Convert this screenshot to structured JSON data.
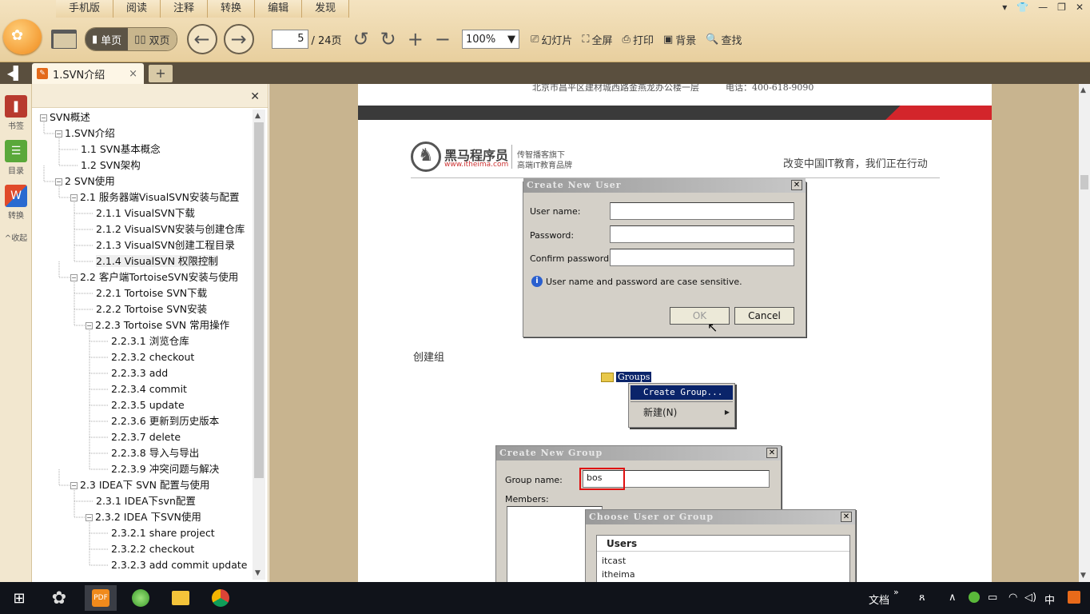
{
  "menu": [
    "手机版",
    "阅读",
    "注释",
    "转换",
    "编辑",
    "发现"
  ],
  "toolbar": {
    "single": "单页",
    "double": "双页",
    "page_current": "5",
    "page_total": "/ 24页",
    "zoom": "100%",
    "slideshow": "幻灯片",
    "fullscreen": "全屏",
    "print": "打印",
    "background": "背景",
    "find": "查找"
  },
  "tab": {
    "title": "1.SVN介绍"
  },
  "leftstrip": {
    "bookmark": "书签",
    "outline": "目录",
    "convert": "转换",
    "collapse": "收起"
  },
  "outline": [
    {
      "label": "SVN概述",
      "lv": 0,
      "tog": "−"
    },
    {
      "label": "1.SVN介绍",
      "lv": 1,
      "tog": "−"
    },
    {
      "label": "1.1 SVN基本概念",
      "lv": 2,
      "tog": ""
    },
    {
      "label": "1.2 SVN架构",
      "lv": 2,
      "tog": ""
    },
    {
      "label": "2 SVN使用",
      "lv": 1,
      "tog": "−"
    },
    {
      "label": "2.1 服务器端VisualSVN安装与配置",
      "lv": 2,
      "tog": "−"
    },
    {
      "label": "2.1.1 VisualSVN下载",
      "lv": 3,
      "tog": ""
    },
    {
      "label": "2.1.2 VisualSVN安装与创建仓库",
      "lv": 3,
      "tog": ""
    },
    {
      "label": "2.1.3 VisualSVN创建工程目录",
      "lv": 3,
      "tog": ""
    },
    {
      "label": "2.1.4 VisualSVN 权限控制",
      "lv": 3,
      "tog": "",
      "selected": true
    },
    {
      "label": "2.2 客户端TortoiseSVN安装与使用",
      "lv": 2,
      "tog": "−"
    },
    {
      "label": "2.2.1 Tortoise SVN下载",
      "lv": 3,
      "tog": ""
    },
    {
      "label": "2.2.2 Tortoise SVN安装",
      "lv": 3,
      "tog": ""
    },
    {
      "label": "2.2.3 Tortoise SVN 常用操作",
      "lv": 3,
      "tog": "−"
    },
    {
      "label": "2.2.3.1 浏览仓库",
      "lv": 4,
      "tog": ""
    },
    {
      "label": "2.2.3.2 checkout",
      "lv": 4,
      "tog": ""
    },
    {
      "label": "2.2.3.3 add",
      "lv": 4,
      "tog": ""
    },
    {
      "label": "2.2.3.4 commit",
      "lv": 4,
      "tog": ""
    },
    {
      "label": "2.2.3.5 update",
      "lv": 4,
      "tog": ""
    },
    {
      "label": "2.2.3.6 更新到历史版本",
      "lv": 4,
      "tog": ""
    },
    {
      "label": "2.2.3.7 delete",
      "lv": 4,
      "tog": ""
    },
    {
      "label": "2.2.3.8 导入与导出",
      "lv": 4,
      "tog": ""
    },
    {
      "label": "2.2.3.9 冲突问题与解决",
      "lv": 4,
      "tog": ""
    },
    {
      "label": "2.3 IDEA下 SVN 配置与使用",
      "lv": 2,
      "tog": "−"
    },
    {
      "label": "2.3.1 IDEA下svn配置",
      "lv": 3,
      "tog": ""
    },
    {
      "label": "2.3.2 IDEA 下SVN使用",
      "lv": 3,
      "tog": "−"
    },
    {
      "label": "2.3.2.1 share project",
      "lv": 4,
      "tog": ""
    },
    {
      "label": "2.3.2.2 checkout",
      "lv": 4,
      "tog": ""
    },
    {
      "label": "2.3.2.3 add commit update",
      "lv": 4,
      "tog": ""
    }
  ],
  "page": {
    "address": "北京市昌平区建材城西路金燕龙办公楼一层　　　电话：400-618-9090",
    "brand_name": "黑马程序员",
    "brand_url": "www.itheima.com",
    "brand_sub1": "传智播客旗下",
    "brand_sub2": "高端IT教育品牌",
    "slogan": "改变中国IT教育，我们正在行动",
    "create_user": {
      "title": "Create New User",
      "username": "User name:",
      "password": "Password:",
      "confirm": "Confirm password:",
      "info": "User name and password are case sensitive.",
      "ok": "OK",
      "cancel": "Cancel"
    },
    "section_label": "创建组",
    "groups_node": "Groups",
    "ctx_create_group": "Create Group...",
    "ctx_new": "新建(N)",
    "create_group": {
      "title": "Create New Group",
      "group_name_label": "Group name:",
      "group_name_value": "bos",
      "members": "Members:"
    },
    "choose": {
      "title": "Choose User or Group",
      "header": "Users",
      "users": [
        "itcast",
        "itheima"
      ]
    }
  },
  "taskbar": {
    "docs": "文档",
    "ime": "中"
  }
}
